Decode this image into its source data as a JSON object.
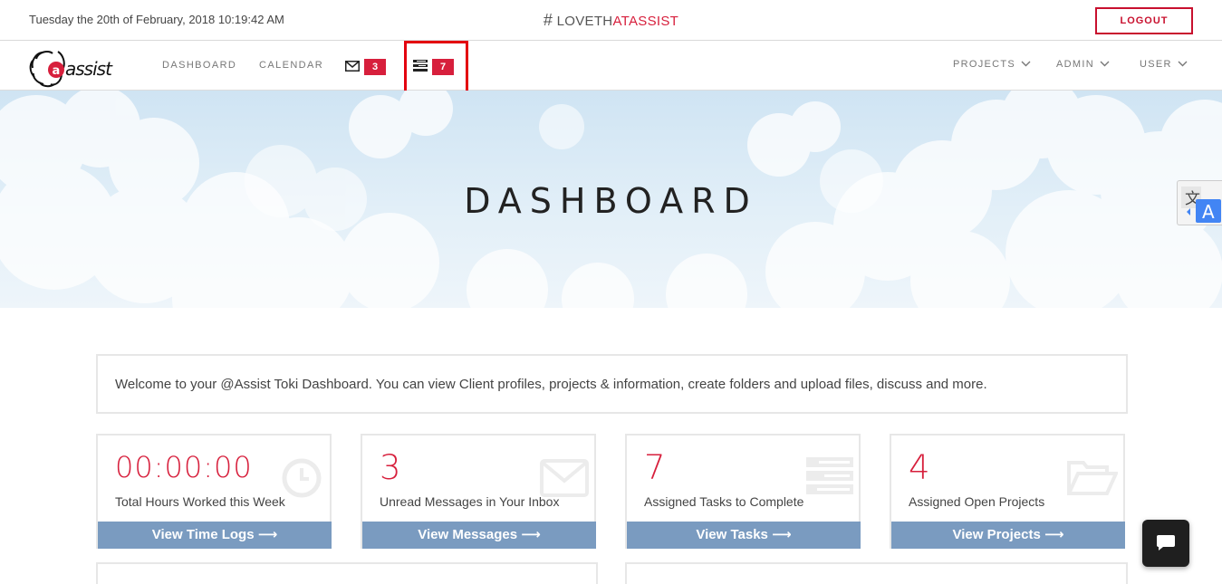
{
  "topbar": {
    "datetime": "Tuesday the 20th of February, 2018 10:19:42 AM",
    "tagline_hash": "#",
    "tagline_prefix": "LOVETH",
    "tagline_accent": "ATASSIST",
    "logout_label": "LOGOUT"
  },
  "nav": {
    "logo_alt": "@assist",
    "dashboard_label": "DASHBOARD",
    "calendar_label": "CALENDAR",
    "messages_badge": "3",
    "tasks_badge": "7",
    "projects_label": "PROJECTS",
    "admin_label": "ADMIN",
    "user_label": "USER"
  },
  "hero": {
    "title": "DASHBOARD"
  },
  "welcome": {
    "text": "Welcome to your @Assist Toki Dashboard. You can view Client profiles, projects & information, create folders and upload files, discuss and more."
  },
  "cards": [
    {
      "value": "00:00:00",
      "label": "Total Hours Worked this Week",
      "action": "View Time Logs ⟶",
      "icon": "clock-icon"
    },
    {
      "value": "3",
      "label": "Unread Messages in Your Inbox",
      "action": "View Messages ⟶",
      "icon": "envelope-icon"
    },
    {
      "value": "7",
      "label": "Assigned Tasks to Complete",
      "action": "View Tasks ⟶",
      "icon": "tasks-icon"
    },
    {
      "value": "4",
      "label": "Assigned Open Projects",
      "action": "View Projects ⟶",
      "icon": "folder-open-icon"
    }
  ],
  "colors": {
    "accent": "#d71f3c",
    "action_bar": "#7a9bc0",
    "highlight_box": "#e3000f"
  }
}
